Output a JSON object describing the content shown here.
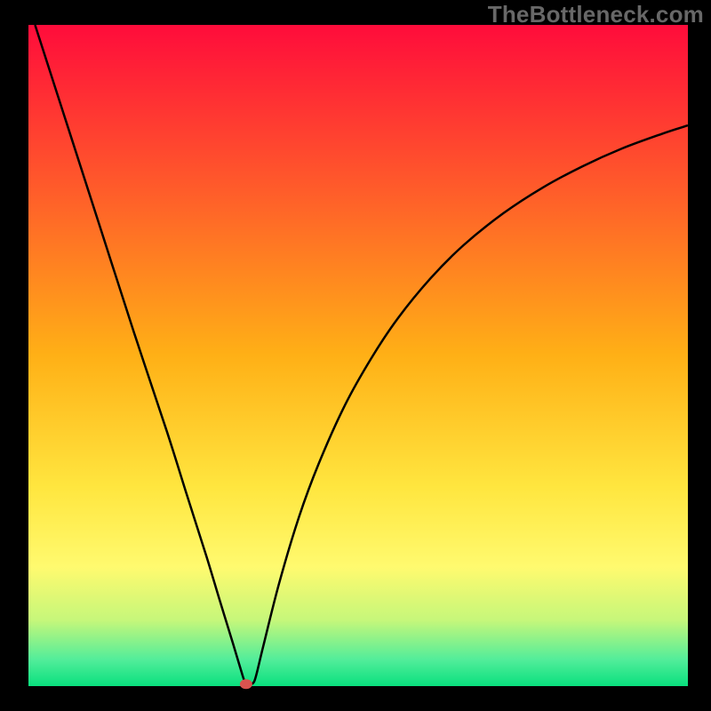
{
  "watermark": "TheBottleneck.com",
  "chart_data": {
    "type": "line",
    "title": "",
    "xlabel": "",
    "ylabel": "",
    "xlim": [
      0,
      100
    ],
    "ylim": [
      0,
      100
    ],
    "background_gradient": [
      {
        "offset": 0.0,
        "color": "#ff0c3b"
      },
      {
        "offset": 0.25,
        "color": "#ff5c2a"
      },
      {
        "offset": 0.5,
        "color": "#ffb016"
      },
      {
        "offset": 0.7,
        "color": "#ffe63f"
      },
      {
        "offset": 0.82,
        "color": "#fffa6f"
      },
      {
        "offset": 0.9,
        "color": "#c6f77a"
      },
      {
        "offset": 0.96,
        "color": "#52ed9a"
      },
      {
        "offset": 1.0,
        "color": "#09e07e"
      }
    ],
    "series": [
      {
        "name": "bottleneck-curve",
        "color": "#000000",
        "points": [
          {
            "x": 1,
            "y": 100
          },
          {
            "x": 6,
            "y": 84.5
          },
          {
            "x": 11,
            "y": 69
          },
          {
            "x": 16,
            "y": 53.5
          },
          {
            "x": 21,
            "y": 38.5
          },
          {
            "x": 24,
            "y": 29
          },
          {
            "x": 27,
            "y": 19.6
          },
          {
            "x": 29,
            "y": 13
          },
          {
            "x": 31,
            "y": 6.5
          },
          {
            "x": 32.2,
            "y": 2.5
          },
          {
            "x": 32.9,
            "y": 0.4
          },
          {
            "x": 33.3,
            "y": 0.4
          },
          {
            "x": 34.0,
            "y": 0.4
          },
          {
            "x": 34.5,
            "y": 1.5
          },
          {
            "x": 35.6,
            "y": 6
          },
          {
            "x": 38,
            "y": 15.5
          },
          {
            "x": 41,
            "y": 25.5
          },
          {
            "x": 44,
            "y": 33.6
          },
          {
            "x": 48,
            "y": 42.5
          },
          {
            "x": 52,
            "y": 49.6
          },
          {
            "x": 56,
            "y": 55.6
          },
          {
            "x": 61,
            "y": 61.7
          },
          {
            "x": 66,
            "y": 66.7
          },
          {
            "x": 72,
            "y": 71.5
          },
          {
            "x": 78,
            "y": 75.4
          },
          {
            "x": 84,
            "y": 78.6
          },
          {
            "x": 90,
            "y": 81.3
          },
          {
            "x": 96,
            "y": 83.5
          },
          {
            "x": 100,
            "y": 84.8
          }
        ]
      }
    ],
    "marker": {
      "x": 33.0,
      "y": 0.3,
      "color": "#d9534f"
    }
  }
}
